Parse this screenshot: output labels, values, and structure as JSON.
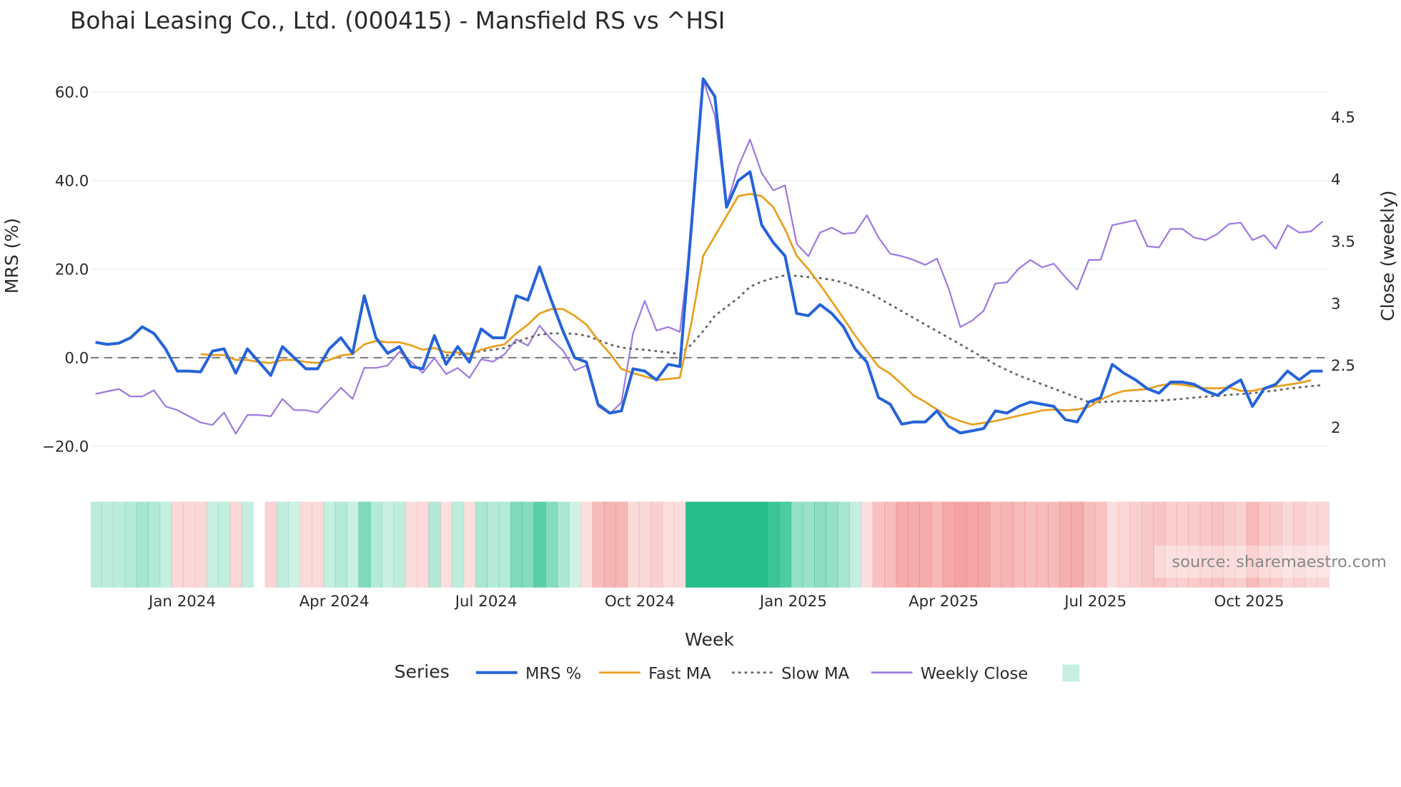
{
  "title": "Bohai Leasing Co., Ltd. (000415) - Mansfield RS vs ^HSI",
  "watermark": "source: sharemaestro.com",
  "chart_data": {
    "type": "line",
    "title": "Bohai Leasing Co., Ltd. (000415) - Mansfield RS vs ^HSI",
    "xlabel": "Week",
    "ylabel": "MRS (%)",
    "y2label": "Close (weekly)",
    "ylim": [
      -26,
      66
    ],
    "y2lim": [
      1.75,
      4.8
    ],
    "yticks": [
      "60.0",
      "40.0",
      "20.0",
      "0.0",
      "−20.0"
    ],
    "ytick_values": [
      60,
      40,
      20,
      0,
      -20
    ],
    "y2ticks": [
      "4.5",
      "4",
      "3.5",
      "3",
      "2.5",
      "2"
    ],
    "y2tick_values": [
      4.5,
      4,
      3.5,
      3,
      2.5,
      2
    ],
    "xticks": [
      "Jan 2024",
      "Apr 2024",
      "Jul 2024",
      "Oct 2024",
      "Jan 2025",
      "Apr 2025",
      "Jul 2025",
      "Oct 2025"
    ],
    "xtick_dates": [
      "2024-01-01",
      "2024-04-01",
      "2024-07-01",
      "2024-10-01",
      "2025-01-01",
      "2025-04-01",
      "2025-07-01",
      "2025-10-01"
    ],
    "reference_line": 0,
    "legend": {
      "title": "Series",
      "placement": "bottom-center"
    },
    "series": [
      {
        "name": "MRS %",
        "axis": "left",
        "color": "#2563d9",
        "style": "solid",
        "start": "2023-11-10",
        "step_days": 7,
        "values": [
          3.5,
          3,
          3.3,
          4.5,
          7,
          5.5,
          2,
          -3,
          -3,
          -3.2,
          1.5,
          2,
          -3.5,
          2,
          -1,
          -4,
          2.5,
          0,
          -2.5,
          -2.5,
          2,
          4.5,
          1,
          14,
          4.5,
          1,
          2.5,
          -2,
          -2.5,
          5,
          -1.5,
          2.5,
          -1,
          6.5,
          4.5,
          4.5,
          14,
          13,
          20.5,
          13,
          6,
          0,
          -1,
          -10.5,
          -12.5,
          -12,
          -2.5,
          -3,
          -5,
          -1.5,
          -2,
          30,
          63,
          59,
          34,
          40,
          42,
          30,
          26,
          23,
          10,
          9.5,
          12,
          10,
          7,
          2,
          -1,
          -9,
          -10.5,
          -15,
          -14.5,
          -14.5,
          -12,
          -15.5,
          -17,
          -16.5,
          -16,
          -12,
          -12.5,
          -11,
          -10,
          -10.5,
          -11,
          -14,
          -14.5,
          -10,
          -9,
          -1.5,
          -3.5,
          -5,
          -7,
          -8,
          -5.5,
          -5.5,
          -6,
          -7.5,
          -8.5,
          -6.5,
          -5,
          -11,
          -7,
          -6,
          -3,
          -5,
          -3,
          -3
        ]
      },
      {
        "name": "Fast MA",
        "axis": "left",
        "color": "#e8a020",
        "style": "solid",
        "start": "2024-01-12",
        "step_days": 7,
        "values": [
          0.8,
          0.6,
          0.6,
          -0.5,
          -0.5,
          -1,
          -1.2,
          -0.5,
          -0.5,
          -1,
          -1.2,
          -0.5,
          0.5,
          0.8,
          3,
          3.8,
          3.5,
          3.5,
          2.8,
          1.8,
          2.2,
          1.2,
          1.2,
          0.8,
          1.8,
          2.5,
          3,
          5.5,
          7.5,
          10,
          11,
          11,
          9.5,
          7.5,
          4,
          1,
          -2.5,
          -3.5,
          -4.2,
          -5,
          -4.8,
          -4.5,
          8,
          23,
          27.5,
          32,
          36.5,
          37,
          36.5,
          34,
          29,
          23,
          20,
          16.5,
          12.7,
          8.9,
          5,
          1.5,
          -2,
          -3.6,
          -6,
          -8.5,
          -10,
          -11.7,
          -13.3,
          -14.3,
          -15.1,
          -14.7,
          -14.3,
          -13.7,
          -13.1,
          -12.5,
          -11.9,
          -11.7,
          -11.9,
          -11.7,
          -11.1,
          -9.5,
          -8.3,
          -7.5,
          -7.3,
          -7.1,
          -6.3,
          -5.9,
          -6.1,
          -6.5,
          -6.9,
          -6.9,
          -6.7,
          -7.5,
          -7.5,
          -6.9,
          -6.5,
          -6.1,
          -5.7,
          -5.1
        ]
      },
      {
        "name": "Slow MA",
        "axis": "left",
        "color": "#666666",
        "style": "dotted",
        "start": "2024-06-07",
        "step_days": 7,
        "values": [
          0.5,
          0.7,
          1,
          1.5,
          1.8,
          2.2,
          3.5,
          4.5,
          5.2,
          5.5,
          5.5,
          5.4,
          5,
          4,
          3,
          2.3,
          2,
          1.8,
          1.5,
          1.2,
          0.8,
          3,
          6,
          9.5,
          11.5,
          13.5,
          16,
          17.2,
          18,
          18.6,
          18.5,
          18.2,
          18,
          17.6,
          17,
          16,
          15,
          13.5,
          12,
          10.5,
          9,
          7.5,
          6,
          4.5,
          3,
          1.5,
          0,
          -1.5,
          -2.8,
          -4,
          -5,
          -6,
          -7,
          -8,
          -9,
          -10,
          -10,
          -9.9,
          -9.8,
          -9.8,
          -9.8,
          -9.7,
          -9.5,
          -9.3,
          -9,
          -8.8,
          -8.6,
          -8.4,
          -8.2,
          -8,
          -7.7,
          -7.4,
          -7,
          -6.7,
          -6.4,
          -6.2
        ]
      },
      {
        "name": "Weekly Close",
        "axis": "right",
        "color": "#9f7be0",
        "style": "solid",
        "start": "2023-11-10",
        "step_days": 7,
        "values": [
          2.27,
          2.29,
          2.31,
          2.25,
          2.25,
          2.3,
          2.17,
          2.14,
          2.09,
          2.04,
          2.02,
          2.12,
          1.95,
          2.1,
          2.1,
          2.09,
          2.23,
          2.14,
          2.14,
          2.12,
          2.22,
          2.32,
          2.23,
          2.48,
          2.48,
          2.5,
          2.61,
          2.53,
          2.44,
          2.56,
          2.43,
          2.48,
          2.4,
          2.55,
          2.53,
          2.59,
          2.71,
          2.66,
          2.82,
          2.71,
          2.62,
          2.46,
          2.5,
          2.17,
          2.11,
          2.2,
          2.76,
          3.02,
          2.78,
          2.81,
          2.77,
          3.57,
          4.8,
          4.51,
          3.79,
          4.1,
          4.32,
          4.05,
          3.91,
          3.95,
          3.48,
          3.38,
          3.57,
          3.61,
          3.56,
          3.57,
          3.71,
          3.53,
          3.4,
          3.38,
          3.35,
          3.31,
          3.36,
          3.12,
          2.81,
          2.86,
          2.94,
          3.16,
          3.17,
          3.28,
          3.35,
          3.29,
          3.32,
          3.21,
          3.11,
          3.35,
          3.35,
          3.63,
          3.65,
          3.67,
          3.46,
          3.45,
          3.6,
          3.6,
          3.53,
          3.51,
          3.56,
          3.64,
          3.65,
          3.51,
          3.55,
          3.44,
          3.63,
          3.57,
          3.58,
          3.66
        ]
      }
    ],
    "heatmap": {
      "source_series": "MRS %",
      "positive_color": "#26bf8c",
      "negative_color": "#f08080",
      "gap_week_index": 14,
      "legend_swatch_color": "#c6efe0"
    }
  }
}
